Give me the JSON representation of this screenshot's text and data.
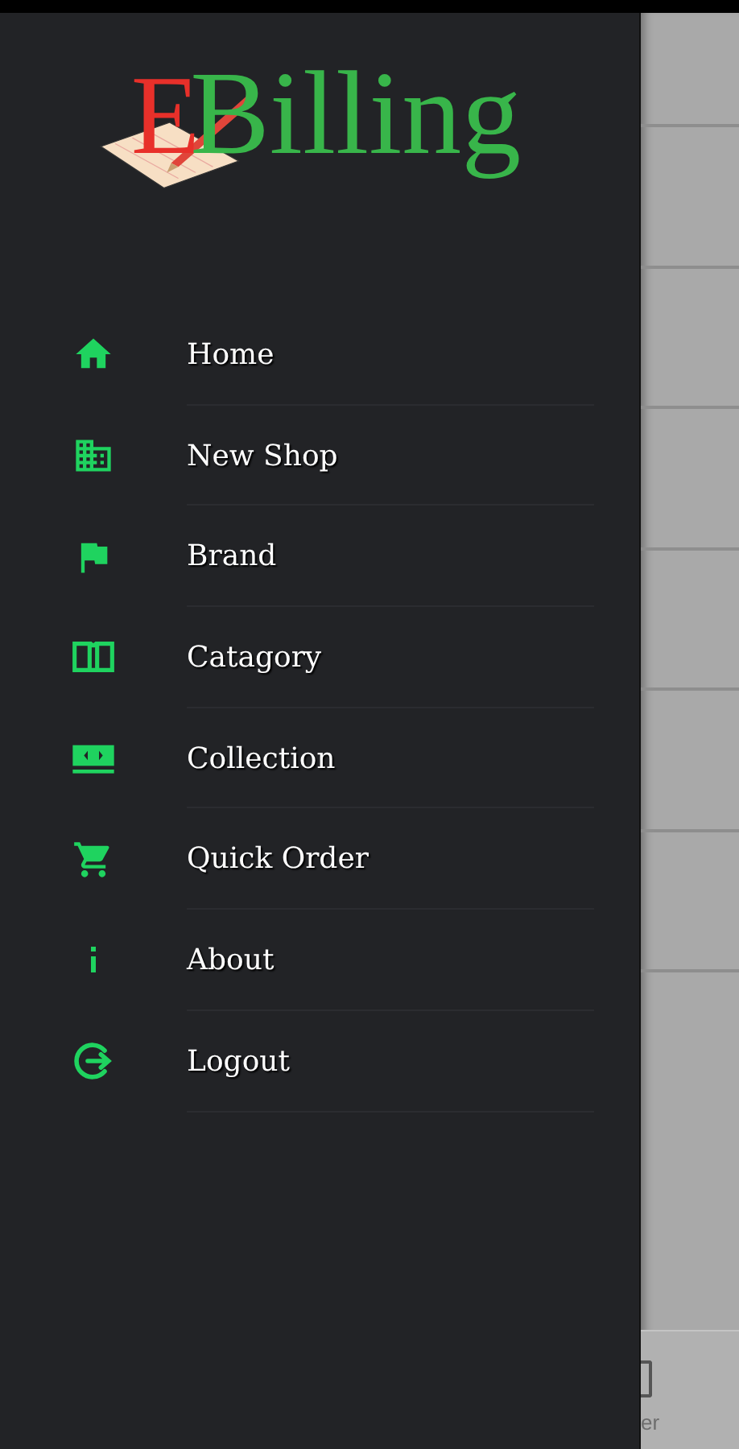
{
  "logo": {
    "letter": "E",
    "word": "Billing"
  },
  "menu": [
    {
      "label": "Home"
    },
    {
      "label": "New Shop"
    },
    {
      "label": "Brand"
    },
    {
      "label": "Catagory"
    },
    {
      "label": "Collection"
    },
    {
      "label": "Quick Order"
    },
    {
      "label": "About"
    },
    {
      "label": "Logout"
    }
  ],
  "bottom_nav": {
    "label": "er"
  }
}
